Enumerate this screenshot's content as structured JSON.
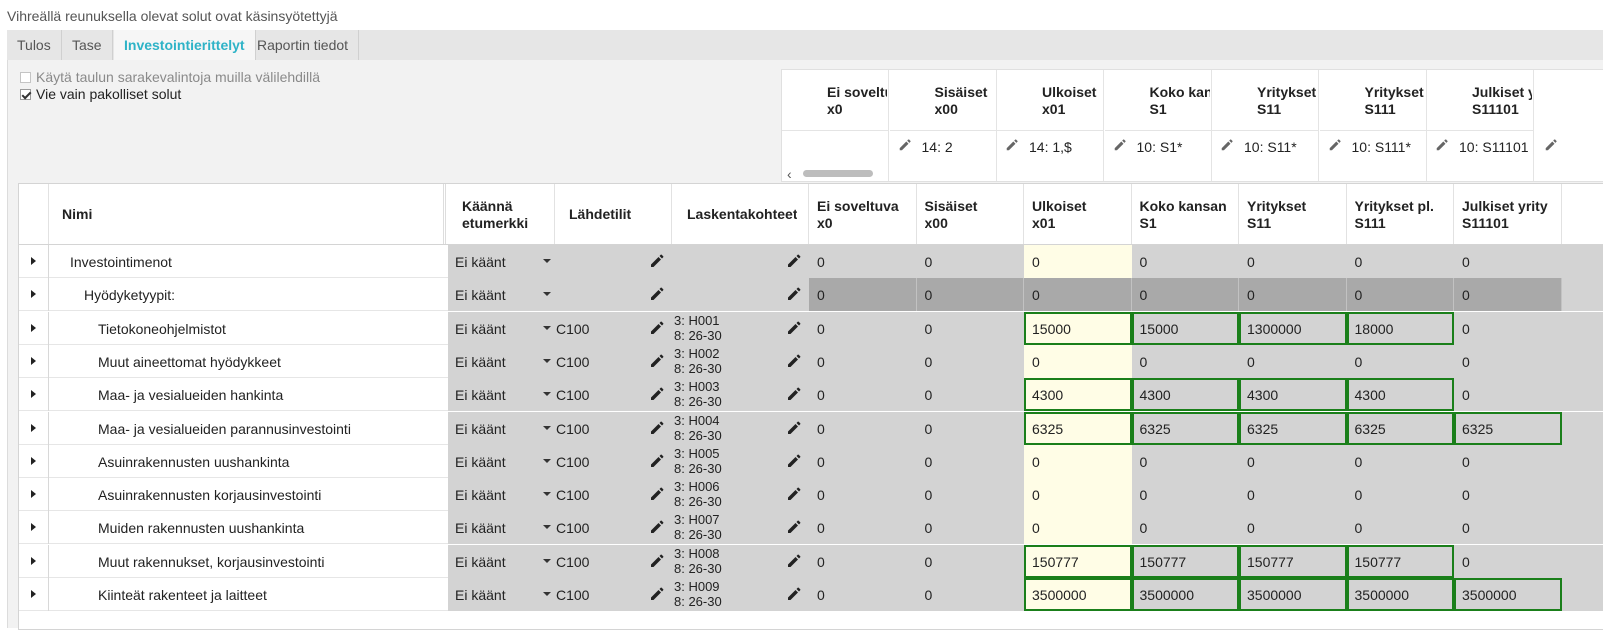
{
  "notice": "Vihreällä reunuksella olevat solut ovat käsinsyötettyjä",
  "tabs": [
    {
      "label": "Tulos",
      "active": false
    },
    {
      "label": "Tase",
      "active": false
    },
    {
      "label": "Investointierittelyt",
      "active": true
    },
    {
      "label": "Raportin tiedot",
      "active": false
    }
  ],
  "options": [
    {
      "label": "Käytä taulun sarakevalintoja muilla välilehdillä",
      "checked": false,
      "disabled": true
    },
    {
      "label": "Vie vain pakolliset solut",
      "checked": true,
      "disabled": false
    }
  ],
  "top_columns": [
    {
      "line1": "Ei soveltuva /",
      "line2": "x0",
      "value": "14: 2"
    },
    {
      "line1": "Sisäiset",
      "line2": "x00",
      "value": "14: 1,$"
    },
    {
      "line1": "Ulkoiset",
      "line2": "x01",
      "value": "10: S1*"
    },
    {
      "line1": "Koko kansan",
      "line2": "S1",
      "value": "10: S11*"
    },
    {
      "line1": "Yritykset",
      "line2": "S11",
      "value": "10: S111*"
    },
    {
      "line1": "Yritykset pl.",
      "line2": "S111",
      "value": "10: S11101"
    },
    {
      "line1": "Julkiset yrity",
      "line2": "S11101",
      "value": ""
    }
  ],
  "main_headers": {
    "name": "Nimi",
    "flip_line1": "Käännä",
    "flip_line2": "etumerkki",
    "source": "Lähdetilit",
    "targets": "Laskentakohteet",
    "columns": [
      {
        "line1": "Ei soveltuva",
        "line2": "x0"
      },
      {
        "line1": "Sisäiset",
        "line2": "x00"
      },
      {
        "line1": "Ulkoiset",
        "line2": "x01"
      },
      {
        "line1": "Koko kansan",
        "line2": "S1"
      },
      {
        "line1": "Yritykset",
        "line2": "S11"
      },
      {
        "line1": "Yritykset pl.",
        "line2": "S111"
      },
      {
        "line1": "Julkiset yrity",
        "line2": "S11101"
      }
    ]
  },
  "rows": [
    {
      "name": "Investointimenot",
      "level": 1,
      "flip": "Ei käänt",
      "source": "",
      "target1": "",
      "target2": "",
      "values": [
        "0",
        "0",
        "0",
        "0",
        "0",
        "0",
        "0"
      ],
      "dark": false,
      "bordered": [
        false,
        false,
        false,
        false,
        false,
        false,
        false
      ]
    },
    {
      "name": "Hyödyketyypit:",
      "level": 2,
      "flip": "Ei käänt",
      "source": "",
      "target1": "",
      "target2": "",
      "values": [
        "0",
        "0",
        "0",
        "0",
        "0",
        "0",
        "0"
      ],
      "dark": true,
      "bordered": [
        false,
        false,
        false,
        false,
        false,
        false,
        false
      ]
    },
    {
      "name": "Tietokoneohjelmistot",
      "level": 3,
      "flip": "Ei käänt",
      "source": "C100",
      "target1": "3: H001",
      "target2": "8: 26-30",
      "values": [
        "0",
        "0",
        "15000",
        "15000",
        "1300000",
        "18000",
        "0"
      ],
      "dark": false,
      "bordered": [
        false,
        false,
        true,
        true,
        true,
        true,
        false
      ]
    },
    {
      "name": "Muut aineettomat hyödykkeet",
      "level": 3,
      "flip": "Ei käänt",
      "source": "C100",
      "target1": "3: H002",
      "target2": "8: 26-30",
      "values": [
        "0",
        "0",
        "0",
        "0",
        "0",
        "0",
        "0"
      ],
      "dark": false,
      "bordered": [
        false,
        false,
        false,
        false,
        false,
        false,
        false
      ]
    },
    {
      "name": "Maa- ja vesialueiden  hankinta",
      "level": 3,
      "flip": "Ei käänt",
      "source": "C100",
      "target1": "3: H003",
      "target2": "8: 26-30",
      "values": [
        "0",
        "0",
        "4300",
        "4300",
        "4300",
        "4300",
        "0"
      ],
      "dark": false,
      "bordered": [
        false,
        false,
        true,
        true,
        true,
        true,
        false
      ]
    },
    {
      "name": "Maa- ja vesialueiden parannusinvestointi",
      "level": 3,
      "flip": "Ei käänt",
      "source": "C100",
      "target1": "3: H004",
      "target2": "8: 26-30",
      "values": [
        "0",
        "0",
        "6325",
        "6325",
        "6325",
        "6325",
        "6325"
      ],
      "dark": false,
      "bordered": [
        false,
        false,
        true,
        true,
        true,
        true,
        true
      ]
    },
    {
      "name": "Asuinrakennusten uushankinta",
      "level": 3,
      "flip": "Ei käänt",
      "source": "C100",
      "target1": "3: H005",
      "target2": "8: 26-30",
      "values": [
        "0",
        "0",
        "0",
        "0",
        "0",
        "0",
        "0"
      ],
      "dark": false,
      "bordered": [
        false,
        false,
        false,
        false,
        false,
        false,
        false
      ]
    },
    {
      "name": "Asuinrakennusten korjausinvestointi",
      "level": 3,
      "flip": "Ei käänt",
      "source": "C100",
      "target1": "3: H006",
      "target2": "8: 26-30",
      "values": [
        "0",
        "0",
        "0",
        "0",
        "0",
        "0",
        "0"
      ],
      "dark": false,
      "bordered": [
        false,
        false,
        false,
        false,
        false,
        false,
        false
      ]
    },
    {
      "name": "Muiden rakennusten uushankinta",
      "level": 3,
      "flip": "Ei käänt",
      "source": "C100",
      "target1": "3: H007",
      "target2": "8: 26-30",
      "values": [
        "0",
        "0",
        "0",
        "0",
        "0",
        "0",
        "0"
      ],
      "dark": false,
      "bordered": [
        false,
        false,
        false,
        false,
        false,
        false,
        false
      ]
    },
    {
      "name": "Muut rakennukset, korjausinvestointi",
      "level": 3,
      "flip": "Ei käänt",
      "source": "C100",
      "target1": "3: H008",
      "target2": "8: 26-30",
      "values": [
        "0",
        "0",
        "150777",
        "150777",
        "150777",
        "150777",
        "0"
      ],
      "dark": false,
      "bordered": [
        false,
        false,
        true,
        true,
        true,
        true,
        false
      ]
    },
    {
      "name": "Kiinteät rakenteet ja laitteet",
      "level": 3,
      "flip": "Ei käänt",
      "source": "C100",
      "target1": "3: H009",
      "target2": "8: 26-30",
      "values": [
        "0",
        "0",
        "3500000",
        "3500000",
        "3500000",
        "3500000",
        "3500000"
      ],
      "dark": false,
      "bordered": [
        false,
        false,
        true,
        true,
        true,
        true,
        true
      ]
    }
  ],
  "colors": {
    "accent": "#2eb3c7",
    "manual_border": "#1a7f1a",
    "editable_bg": "#fffde6",
    "readonly_bg": "#d3d3d3"
  }
}
